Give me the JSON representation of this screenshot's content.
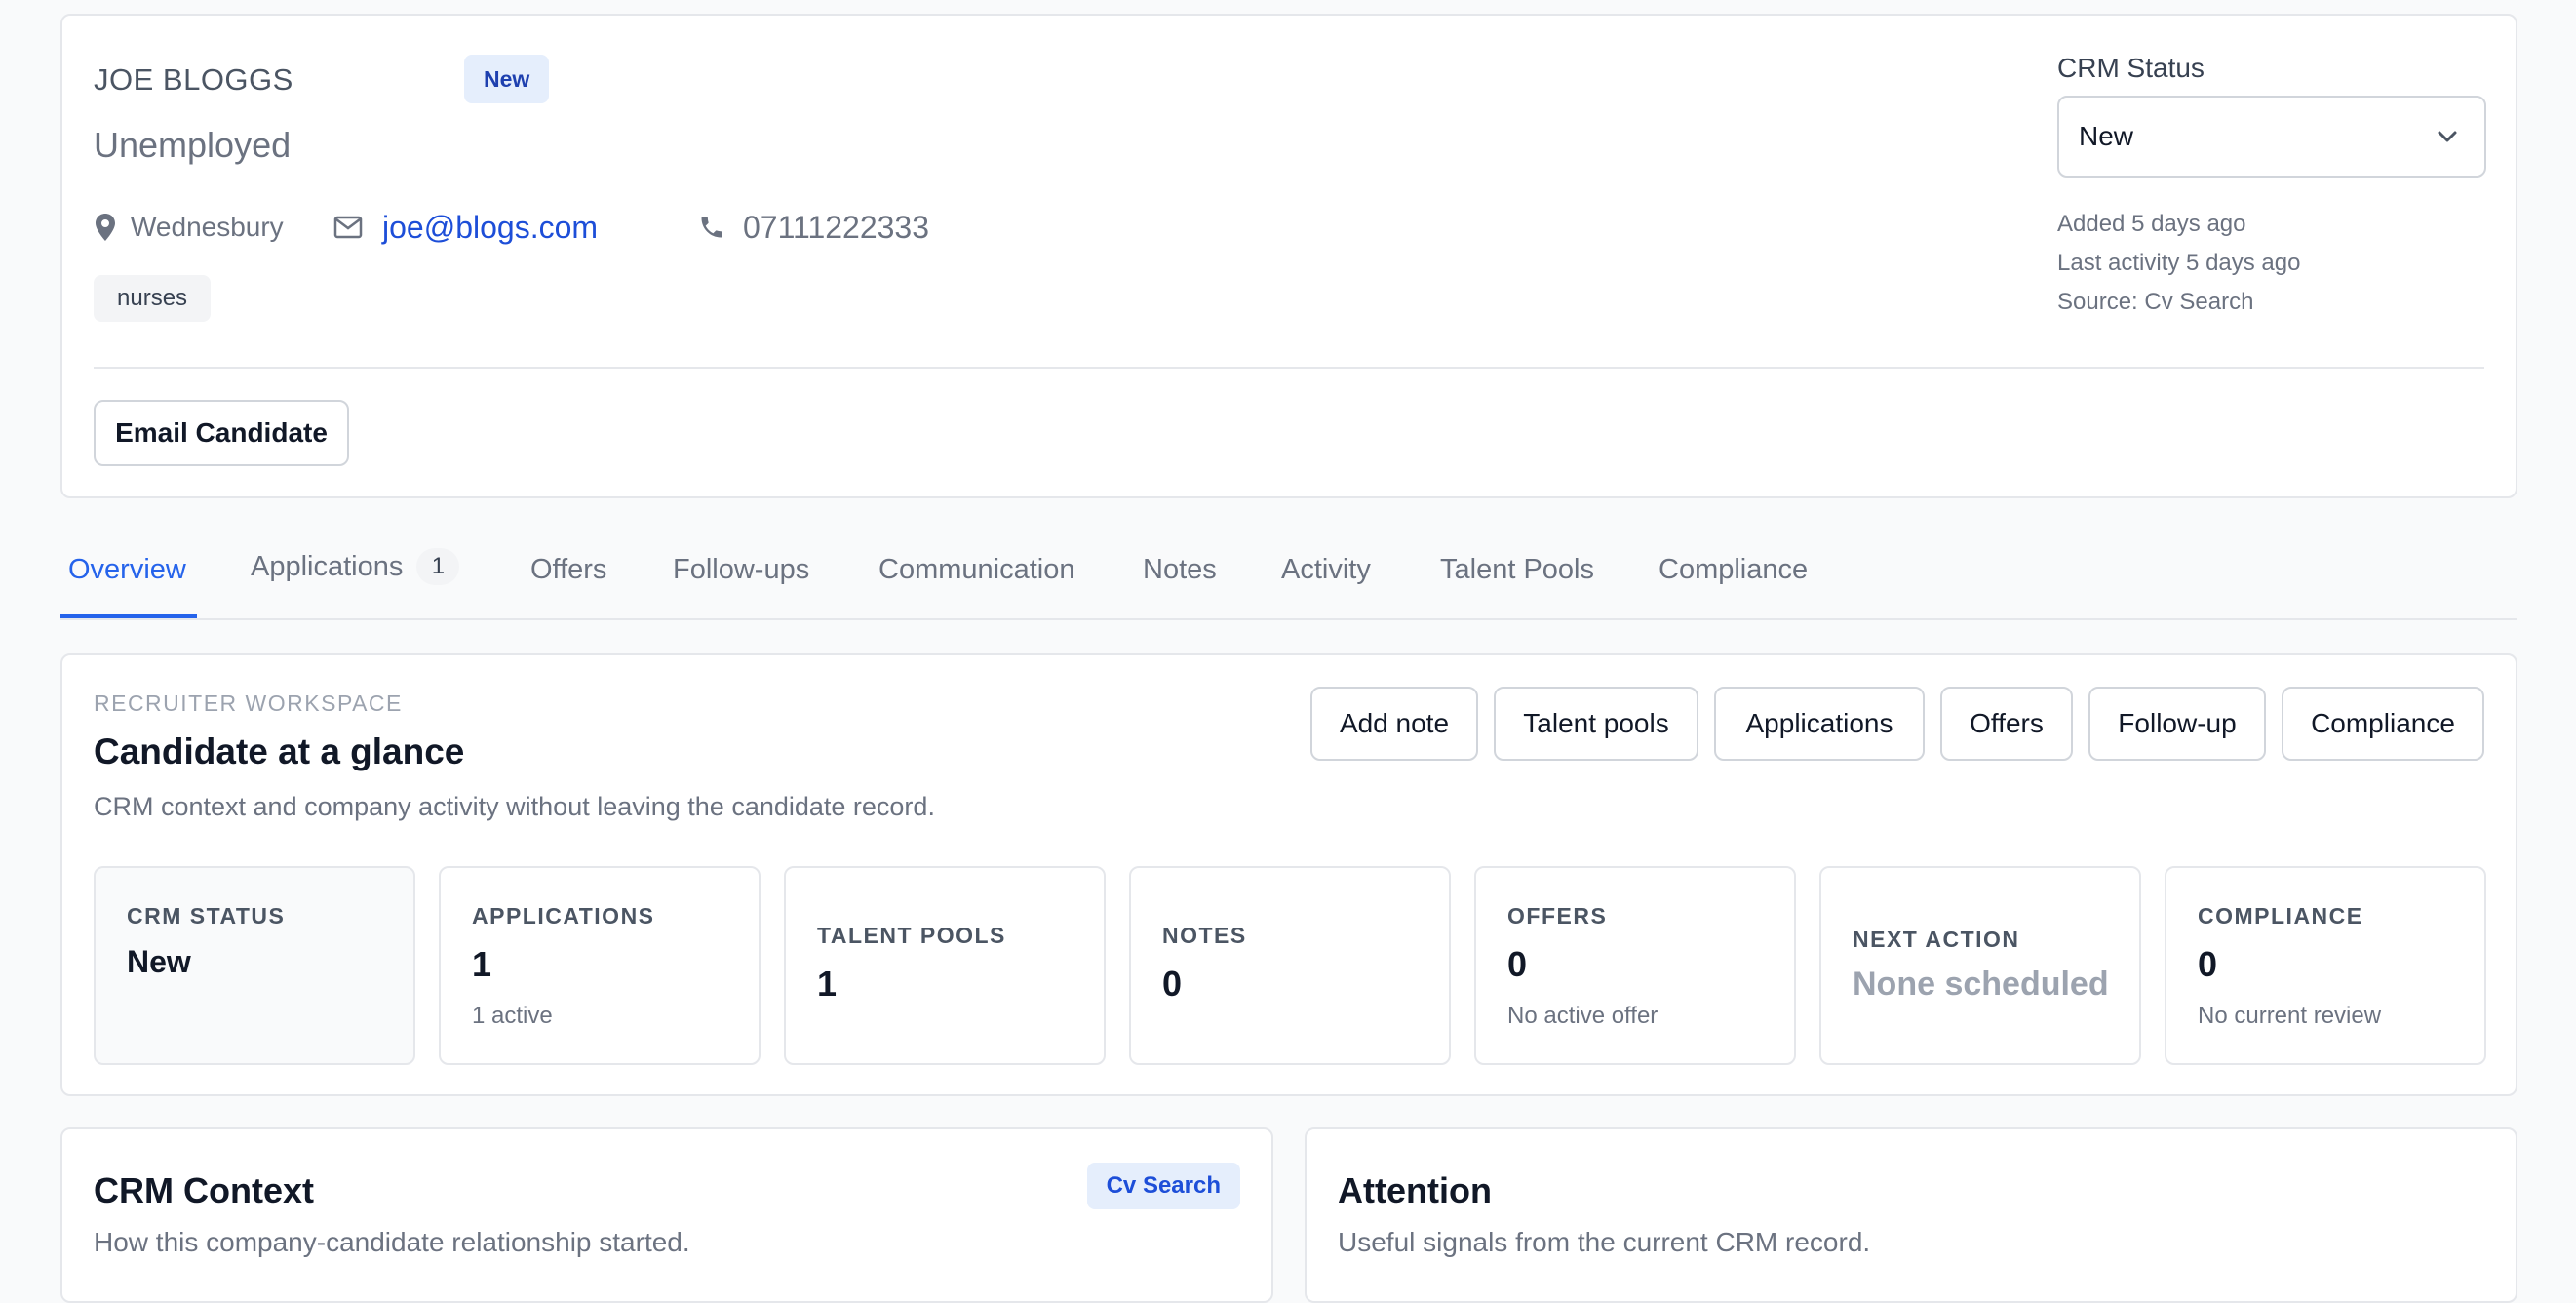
{
  "candidate": {
    "name": "JOE BLOGGS",
    "badge": "New",
    "role": "Unemployed",
    "location": "Wednesbury",
    "email": "joe@blogs.com",
    "phone": "07111222333",
    "tag": "nurses",
    "email_button": "Email Candidate"
  },
  "crm": {
    "status_label": "CRM Status",
    "status_value": "New",
    "added": "Added 5 days ago",
    "last_activity": "Last activity 5 days ago",
    "source": "Source: Cv Search"
  },
  "tabs": [
    {
      "label": "Overview",
      "active": true
    },
    {
      "label": "Applications",
      "count": "1"
    },
    {
      "label": "Offers"
    },
    {
      "label": "Follow-ups"
    },
    {
      "label": "Communication"
    },
    {
      "label": "Notes"
    },
    {
      "label": "Activity"
    },
    {
      "label": "Talent Pools"
    },
    {
      "label": "Compliance"
    }
  ],
  "workspace": {
    "eyebrow": "RECRUITER WORKSPACE",
    "title": "Candidate at a glance",
    "subtitle": "CRM context and company activity without leaving the candidate record.",
    "actions": [
      "Add note",
      "Talent pools",
      "Applications",
      "Offers",
      "Follow-up",
      "Compliance"
    ],
    "stats": [
      {
        "label": "CRM STATUS",
        "value": "New"
      },
      {
        "label": "APPLICATIONS",
        "value": "1",
        "sub": "1 active"
      },
      {
        "label": "TALENT POOLS",
        "value": "1"
      },
      {
        "label": "NOTES",
        "value": "0"
      },
      {
        "label": "OFFERS",
        "value": "0",
        "sub": "No active offer"
      },
      {
        "label": "NEXT ACTION",
        "value": "None scheduled"
      },
      {
        "label": "COMPLIANCE",
        "value": "0",
        "sub": "No current review"
      }
    ]
  },
  "crm_context": {
    "title": "CRM Context",
    "subtitle": "How this company-candidate relationship started.",
    "badge": "Cv Search"
  },
  "attention": {
    "title": "Attention",
    "subtitle": "Useful signals from the current CRM record."
  },
  "colors": {
    "accent": "#2563eb",
    "badge_bg": "#e5eefc",
    "link": "#1d4ed8"
  }
}
